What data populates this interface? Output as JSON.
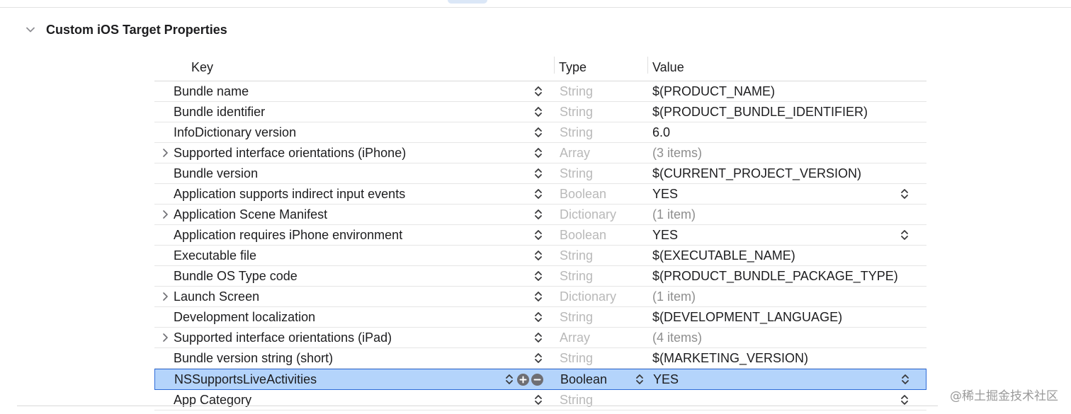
{
  "section": {
    "title": "Custom iOS Target Properties"
  },
  "columns": {
    "key": "Key",
    "type": "Type",
    "value": "Value"
  },
  "rows": [
    {
      "key": "Bundle name",
      "type": "String",
      "value": "$(PRODUCT_NAME)",
      "expandable": false,
      "value_stepper": false,
      "muted": false
    },
    {
      "key": "Bundle identifier",
      "type": "String",
      "value": "$(PRODUCT_BUNDLE_IDENTIFIER)",
      "expandable": false,
      "value_stepper": false,
      "muted": false
    },
    {
      "key": "InfoDictionary version",
      "type": "String",
      "value": "6.0",
      "expandable": false,
      "value_stepper": false,
      "muted": false
    },
    {
      "key": "Supported interface orientations (iPhone)",
      "type": "Array",
      "value": "(3 items)",
      "expandable": true,
      "value_stepper": false,
      "muted": true
    },
    {
      "key": "Bundle version",
      "type": "String",
      "value": "$(CURRENT_PROJECT_VERSION)",
      "expandable": false,
      "value_stepper": false,
      "muted": false
    },
    {
      "key": "Application supports indirect input events",
      "type": "Boolean",
      "value": "YES",
      "expandable": false,
      "value_stepper": true,
      "muted": false
    },
    {
      "key": "Application Scene Manifest",
      "type": "Dictionary",
      "value": "(1 item)",
      "expandable": true,
      "value_stepper": false,
      "muted": true
    },
    {
      "key": "Application requires iPhone environment",
      "type": "Boolean",
      "value": "YES",
      "expandable": false,
      "value_stepper": true,
      "muted": false
    },
    {
      "key": "Executable file",
      "type": "String",
      "value": "$(EXECUTABLE_NAME)",
      "expandable": false,
      "value_stepper": false,
      "muted": false
    },
    {
      "key": "Bundle OS Type code",
      "type": "String",
      "value": "$(PRODUCT_BUNDLE_PACKAGE_TYPE)",
      "expandable": false,
      "value_stepper": false,
      "muted": false
    },
    {
      "key": "Launch Screen",
      "type": "Dictionary",
      "value": "(1 item)",
      "expandable": true,
      "value_stepper": false,
      "muted": true
    },
    {
      "key": "Development localization",
      "type": "String",
      "value": "$(DEVELOPMENT_LANGUAGE)",
      "expandable": false,
      "value_stepper": false,
      "muted": false
    },
    {
      "key": "Supported interface orientations (iPad)",
      "type": "Array",
      "value": "(4 items)",
      "expandable": true,
      "value_stepper": false,
      "muted": true
    },
    {
      "key": "Bundle version string (short)",
      "type": "String",
      "value": "$(MARKETING_VERSION)",
      "expandable": false,
      "value_stepper": false,
      "muted": false
    },
    {
      "key": "NSSupportsLiveActivities",
      "type": "Boolean",
      "value": "YES",
      "expandable": false,
      "value_stepper": true,
      "muted": false,
      "selected": true
    },
    {
      "key": "App Category",
      "type": "String",
      "value": "",
      "expandable": false,
      "value_stepper": true,
      "muted": false
    }
  ],
  "watermark": "@稀土掘金技术社区",
  "colors": {
    "selection": "#b4d4fb",
    "selection_border": "#2d6bd8",
    "muted_type": "#b9b9b9"
  }
}
